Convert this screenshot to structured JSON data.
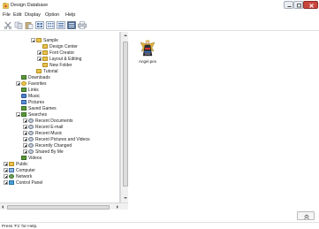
{
  "window": {
    "title": "Design Database"
  },
  "menu": [
    "File",
    "Edit",
    "Display",
    "Option",
    "Help"
  ],
  "toolbar": {
    "buttons": [
      "cut-icon",
      "copy-icon",
      "paste-icon",
      "large-icons-view-icon",
      "small-icons-view-icon",
      "list-view-icon",
      "details-view-icon",
      "print-icon"
    ]
  },
  "tree": {
    "items": [
      {
        "label": "Sample",
        "icon": "folder-open-icon",
        "expander": "minus"
      },
      {
        "label": "Design Center",
        "icon": "folder-icon",
        "expander": "none"
      },
      {
        "label": "Font Creator",
        "icon": "folder-icon",
        "expander": "plus"
      },
      {
        "label": "Layout & Editing",
        "icon": "folder-icon",
        "expander": "plus"
      },
      {
        "label": "New Folder",
        "icon": "folder-icon",
        "expander": "none"
      },
      {
        "label": "Tutorial",
        "icon": "folder-icon",
        "expander": "none"
      },
      {
        "label": "Downloads",
        "icon": "downloads-icon",
        "expander": "none"
      },
      {
        "label": "Favorites",
        "icon": "favorites-icon",
        "expander": "plus"
      },
      {
        "label": "Links",
        "icon": "links-icon",
        "expander": "none"
      },
      {
        "label": "Music",
        "icon": "music-icon",
        "expander": "none"
      },
      {
        "label": "Pictures",
        "icon": "pictures-icon",
        "expander": "none"
      },
      {
        "label": "Saved Games",
        "icon": "saved-games-icon",
        "expander": "none"
      },
      {
        "label": "Searches",
        "icon": "searches-icon",
        "expander": "minus"
      },
      {
        "label": "Recent Documents",
        "icon": "saved-search-icon",
        "expander": "plus"
      },
      {
        "label": "Recent E-mail",
        "icon": "saved-search-icon",
        "expander": "plus"
      },
      {
        "label": "Recent Music",
        "icon": "saved-search-icon",
        "expander": "plus"
      },
      {
        "label": "Recent Pictures and Videos",
        "icon": "saved-search-icon",
        "expander": "plus"
      },
      {
        "label": "Recently Changed",
        "icon": "saved-search-icon",
        "expander": "plus"
      },
      {
        "label": "Shared By Me",
        "icon": "saved-search-icon",
        "expander": "plus"
      },
      {
        "label": "Videos",
        "icon": "videos-icon",
        "expander": "none"
      },
      {
        "label": "Public",
        "icon": "folder-icon",
        "expander": "plus"
      },
      {
        "label": "Computer",
        "icon": "computer-icon",
        "expander": "plus"
      },
      {
        "label": "Network",
        "icon": "network-icon",
        "expander": "plus"
      },
      {
        "label": "Control Panel",
        "icon": "control-panel-icon",
        "expander": "plus"
      }
    ]
  },
  "files": [
    {
      "name": "Angel.pes",
      "icon": "embroidery-design-icon"
    }
  ],
  "status": {
    "text": "Press 'F1' for Help."
  },
  "colors": {
    "close_button": "#c9463d",
    "folder": "#e9c44c",
    "selection_accent": "#3c6ea8"
  }
}
